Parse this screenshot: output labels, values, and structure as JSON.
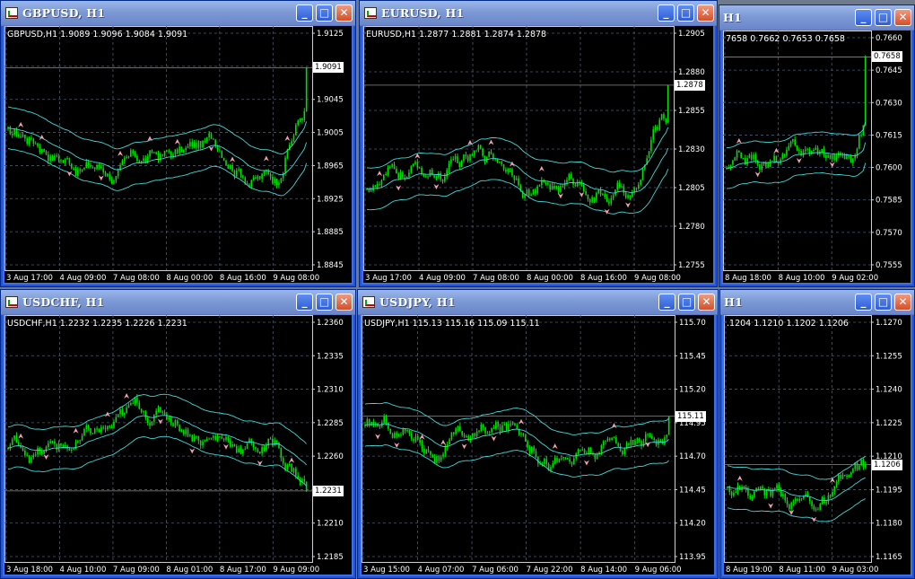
{
  "colors": {
    "candle": "#00e000",
    "band": "#3fd8d8",
    "grid": "#475a7a",
    "arrow": "#f4a0b6",
    "bg": "#000000"
  },
  "windows": [
    {
      "id": "gbpusd",
      "title": "GBPUSD, H1",
      "label": "GBPUSD,H1  1.9089 1.9096 1.9084 1.9091",
      "price": "1.9091",
      "price_value": 1.9091,
      "min": 1.884,
      "max": 1.9135,
      "y_ticks": [
        "1.9125",
        "1.9085",
        "1.9045",
        "1.9005",
        "1.8965",
        "1.8925",
        "1.8885",
        "1.8845"
      ],
      "x_ticks": [
        "3 Aug 17:00",
        "4 Aug 09:00",
        "7 Aug 08:00",
        "8 Aug 00:00",
        "8 Aug 16:00",
        "9 Aug 08:00"
      ],
      "buttons": {
        "minimize": "_",
        "maximize": "□",
        "close": "✕"
      }
    },
    {
      "id": "eurusd",
      "title": "EURUSD, H1",
      "label": "EURUSD,H1  1.2877 1.2881 1.2874 1.2878",
      "price": "1.2878",
      "price_value": 1.2878,
      "min": 1.275,
      "max": 1.2915,
      "y_ticks": [
        "1.2905",
        "1.2880",
        "1.2855",
        "1.2830",
        "1.2805",
        "1.2780",
        "1.2755"
      ],
      "x_ticks": [
        "3 Aug 17:00",
        "4 Aug 09:00",
        "7 Aug 08:00",
        "8 Aug 00:00",
        "8 Aug 16:00",
        "9 Aug 08:00"
      ],
      "buttons": {
        "minimize": "_",
        "maximize": "□",
        "close": "✕"
      }
    },
    {
      "id": "w3",
      "title": "H1",
      "label": "7658 0.7662 0.7653 0.7658",
      "price": "0.7658",
      "price_value": 0.7658,
      "min": 0.755,
      "max": 0.7668,
      "y_ticks": [
        "0.7660",
        "0.7645",
        "0.7630",
        "0.7615",
        "0.7600",
        "0.7585",
        "0.7570",
        "0.7555"
      ],
      "x_ticks": [
        "8 Aug 18:00",
        "8 Aug 10:00",
        "9 Aug 02:00"
      ],
      "buttons": {
        "minimize": "_",
        "maximize": "□",
        "close": "✕"
      }
    },
    {
      "id": "usdchf",
      "title": "USDCHF, H1",
      "label": "USDCHF,H1  1.2232 1.2235 1.2226 1.2231",
      "price": "1.2231",
      "price_value": 1.2231,
      "min": 1.218,
      "max": 1.2362,
      "y_ticks": [
        "1.2360",
        "1.2335",
        "1.2310",
        "1.2285",
        "1.2260",
        "1.2235",
        "1.2210",
        "1.2185"
      ],
      "x_ticks": [
        "3 Aug 18:00",
        "4 Aug 10:00",
        "7 Aug 09:00",
        "8 Aug 01:00",
        "8 Aug 17:00",
        "9 Aug 09:00"
      ],
      "buttons": {
        "minimize": "_",
        "maximize": "□",
        "close": "✕"
      }
    },
    {
      "id": "usdjpy",
      "title": "USDJPY, H1",
      "label": "USDJPY,H1  115.13 115.16 115.09 115.11",
      "price": "115.11",
      "price_value": 115.11,
      "min": 113.9,
      "max": 115.92,
      "y_ticks": [
        "115.70",
        "115.45",
        "115.20",
        "114.95",
        "114.70",
        "114.45",
        "114.20",
        "113.95"
      ],
      "x_ticks": [
        "3 Aug 15:00",
        "4 Aug 07:00",
        "7 Aug 06:00",
        "7 Aug 22:00",
        "8 Aug 14:00",
        "9 Aug 06:00"
      ],
      "buttons": {
        "minimize": "_",
        "maximize": "□",
        "close": "✕"
      }
    },
    {
      "id": "w6",
      "title": "H1",
      "label": ".1204 1.1210 1.1202 1.1206",
      "price": "1.1206",
      "price_value": 1.1206,
      "min": 1.1155,
      "max": 1.1285,
      "y_ticks": [
        "1.1270",
        "1.1255",
        "1.1240",
        "1.1225",
        "1.1210",
        "1.1195",
        "1.1180",
        "1.1165"
      ],
      "x_ticks": [
        "8 Aug 19:00",
        "8 Aug 11:00",
        "9 Aug 03:00"
      ],
      "buttons": {
        "minimize": "_",
        "maximize": "□",
        "close": "✕"
      }
    }
  ]
}
